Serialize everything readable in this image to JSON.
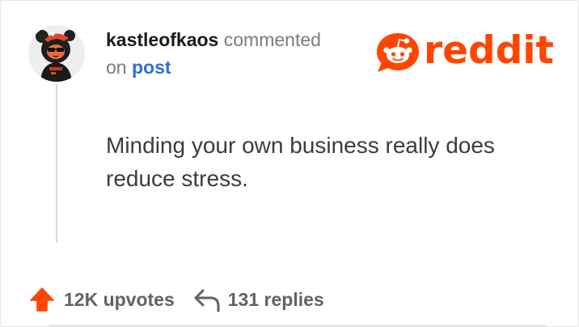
{
  "comment_card": {
    "username": "kastleofkaos",
    "action_text": "commented",
    "on_text": "on",
    "post_link": "post",
    "body": "Minding your own business really does reduce stress.",
    "brand": {
      "name": "reddit",
      "icon": "reddit-alien-icon",
      "color": "#ff4500"
    },
    "stats": {
      "upvotes_label": "12K upvotes",
      "upvote_icon": "upvote-arrow-icon",
      "replies_label": "131 replies",
      "reply_icon": "reply-arrow-icon"
    },
    "avatar_icon": "user-avatar-icon"
  }
}
